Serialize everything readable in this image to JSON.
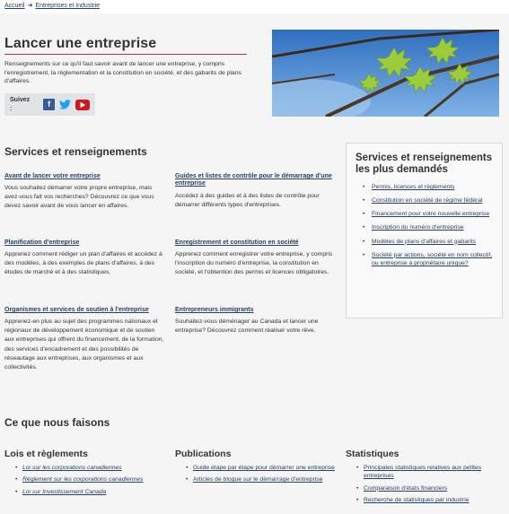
{
  "breadcrumb": {
    "home": "Accueil",
    "current": "Entreprises et industrie"
  },
  "hero": {
    "title": "Lancer une entreprise",
    "description": "Renseignements sur ce qu'il faut savoir avant de lancer une entreprise, y compris l'enregistrement, la réglementation et la constitution en société, et des gabarits de plans d'affaires.",
    "follow_label": "Suivez :",
    "social": [
      "facebook-icon",
      "twitter-icon",
      "youtube-icon"
    ],
    "image": "maple-leaves-photo"
  },
  "services": {
    "title": "Services et renseignements",
    "items": [
      {
        "title": "Avant de lancer votre entreprise",
        "text": "Vous souhaitez démarrer votre propre entreprise, mais avez-vous fait vos recherches? Découvrez ce que vous devez savoir avant de vous lancer en affaires."
      },
      {
        "title": "Guides et listes de contrôle pour le démarrage d'une entreprise",
        "text": "Accédez à des guides et à des listes de contrôle pour démarrer différents types d'entreprises."
      },
      {
        "title": "Planification d'entreprise",
        "text": "Apprenez comment rédiger un plan d'affaires et accédez à des modèles, à des exemples de plans d'affaires, à des études de marché et à des statistiques."
      },
      {
        "title": "Enregistrement et constitution en société",
        "text": "Apprenez comment enregistrer votre entreprise, y compris l'inscription du numéro d'entreprise, la constitution en société, et l'obtention des permis et licences obligatoires."
      },
      {
        "title": "Organismes et services de soutien à l'entreprise",
        "text": "Apprenez-en plus au sujet des programmes nationaux et régionaux de développement économique et de soutien aux entreprises qui offrent du financement, de la formation, des services d'encadrement et des possibilités de réseautage aux entreprises, aux organismes et aux collectivités."
      },
      {
        "title": "Entrepreneurs immigrants",
        "text": "Souhaitez-vous déménager au Canada et lancer une entreprise? Découvrez comment réaliser votre rêve."
      }
    ]
  },
  "popular": {
    "title": "Services et renseignements les plus demandés",
    "items": [
      "Permis, licences et règlements",
      "Constitution en société de régime fédéral",
      "Financement pour votre nouvelle entreprise",
      "Inscription du numéro d'entreprise",
      "Modèles de plans d'affaires et gabarits",
      "Société par actions, société en nom collectif, ou entreprise à propriétaire unique?"
    ]
  },
  "what_we_do": {
    "title": "Ce que nous faisons",
    "columns": [
      {
        "title": "Lois et règlements",
        "items": [
          "Loi sur les corporations canadiennes",
          "Règlement sur les corporations canadiennes",
          "Loi sur Investissement Canada"
        ]
      },
      {
        "title": "Publications",
        "items": [
          "Guide étape par étape pour démarrer une entreprise",
          "Articles de blogue sur le démarrage d'entreprise"
        ]
      },
      {
        "title": "Statistiques",
        "items": [
          "Principales statistiques relatives aux petites entreprises",
          "Comparaison d'états financiers",
          "Recherche de statistiques par industrie"
        ]
      }
    ]
  }
}
